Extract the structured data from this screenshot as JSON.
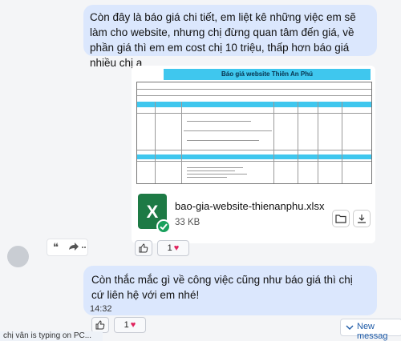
{
  "message1": {
    "text": "Còn đây là báo giá chi tiết, em liệt kê những việc em sẽ làm cho website, nhưng chị đừng quan tâm đến giá, về phần giá thì em em cost chị 10 triệu, thấp hơn báo giá nhiều chị ạ"
  },
  "attachment": {
    "sheet_title": "Báo giá website  Thiên An Phú",
    "file_name": "bao-gia-website-thienanphu.xlsx",
    "file_size": "33 KB"
  },
  "reactions1": {
    "count": "1"
  },
  "message2": {
    "text": "Còn thắc mắc gì về công việc cũng như báo giá thì chị cứ liên hệ với em nhé!",
    "time": "14:32"
  },
  "reactions2": {
    "count": "1"
  },
  "new_messages": {
    "label": "New messag"
  },
  "typing": {
    "text": "chị vân is typing on PC..."
  },
  "colors": {
    "bubble": "#dbe7fd",
    "excel_green": "#1d7a45",
    "heart": "#e0245e",
    "sheet_header": "#3fc7ee"
  }
}
